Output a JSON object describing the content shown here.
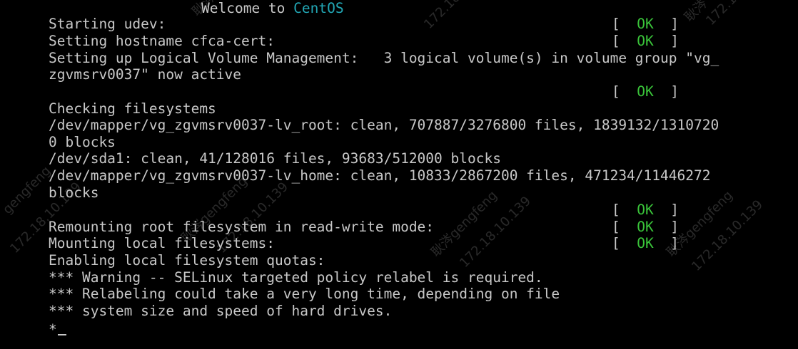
{
  "header": {
    "welcome_prefix": "Welcome to ",
    "os_name": "CentOS"
  },
  "lines": {
    "l1": "Starting udev:",
    "l2": "Setting hostname cfca-cert:",
    "l3": "Setting up Logical Volume Management:   3 logical volume(s) in volume group \"vg_",
    "l4": "zgvmsrv0037\" now active",
    "l6": "Checking filesystems",
    "l7": "/dev/mapper/vg_zgvmsrv0037-lv_root: clean, 707887/3276800 files, 1839132/1310720",
    "l8": "0 blocks",
    "l9": "/dev/sda1: clean, 41/128016 files, 93683/512000 blocks",
    "l10": "/dev/mapper/vg_zgvmsrv0037-lv_home: clean, 10833/2867200 files, 471234/11446272",
    "l11": "blocks",
    "l13": "Remounting root filesystem in read-write mode:",
    "l14": "Mounting local filesystems:",
    "l15": "Enabling local filesystem quotas:",
    "l16": "*** Warning -- SELinux targeted policy relabel is required.",
    "l17": "*** Relabeling could take a very long time, depending on file",
    "l18": "*** system size and speed of hard drives.",
    "l19": "*"
  },
  "status": {
    "open": "[  ",
    "ok": "OK",
    "close": "  ]"
  },
  "watermark": {
    "name": "耿涔gengfeng",
    "ip": "172.18.10.139",
    "name_short": "耿涔",
    "name_alt": "gengfeng"
  },
  "colors": {
    "background": "#000000",
    "text": "#c8c8c8",
    "ok": "#3ac43a",
    "brand": "#22a7b5"
  }
}
